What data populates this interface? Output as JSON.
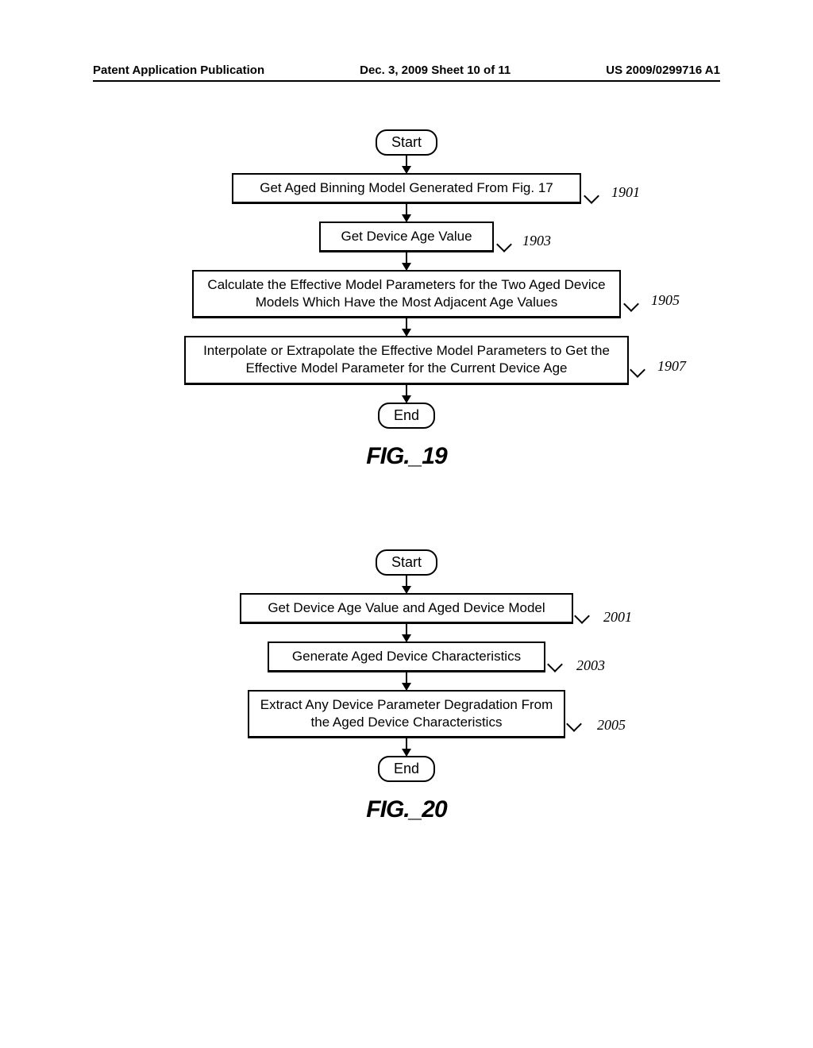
{
  "header": {
    "left": "Patent Application Publication",
    "center": "Dec. 3, 2009  Sheet 10 of 11",
    "right": "US 2009/0299716 A1"
  },
  "fig19": {
    "start": "Start",
    "step1": "Get Aged Binning Model Generated From Fig. 17",
    "ref1": "1901",
    "step2": "Get Device Age Value",
    "ref2": "1903",
    "step3": "Calculate the Effective Model Parameters for the Two Aged Device Models Which Have the Most Adjacent Age Values",
    "ref3": "1905",
    "step4": "Interpolate or Extrapolate the Effective Model Parameters to Get the Effective Model Parameter for the Current Device Age",
    "ref4": "1907",
    "end": "End",
    "label": "FIG._19"
  },
  "fig20": {
    "start": "Start",
    "step1": "Get Device Age Value and Aged Device Model",
    "ref1": "2001",
    "step2": "Generate Aged Device Characteristics",
    "ref2": "2003",
    "step3": "Extract Any Device Parameter Degradation From the Aged Device Characteristics",
    "ref3": "2005",
    "end": "End",
    "label": "FIG._20"
  }
}
